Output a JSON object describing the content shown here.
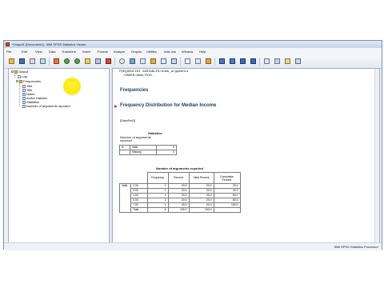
{
  "window": {
    "title": "*Output1 [Document1] - IBM SPSS Statistics Viewer"
  },
  "menu": [
    "File",
    "Edit",
    "View",
    "Data",
    "Transform",
    "Insert",
    "Format",
    "Analyze",
    "Graphs",
    "Utilities",
    "Add-ons",
    "Window",
    "Help"
  ],
  "outline": {
    "root": "Output",
    "log": "Log",
    "frequencies": "Frequencies",
    "children": [
      "Title",
      "Title",
      "Notes",
      "Active Dataset",
      "Statistics",
      "Number of arguments reported"
    ]
  },
  "content": {
    "syntax_line1": "FREQUENCIES VARIABLES=numb_arguments",
    "syntax_line2": "  /ORDER=ANALYSIS.",
    "heading": "Frequencies",
    "subheading": "Frequency Distribution for Median Income",
    "dataset": "[DataSet0]",
    "statistics": {
      "title": "Statistics",
      "var_label": "Number of arguments reported",
      "n": "N",
      "valid": "Valid",
      "valid_val": "5",
      "missing": "Missing",
      "missing_val": "0"
    },
    "freq_table": {
      "title": "Number of arguments reported",
      "headers": [
        "Frequency",
        "Percent",
        "Valid Percent",
        "Cumulative Percent"
      ],
      "group_label": "Valid",
      "rows": [
        [
          "2.00",
          "1",
          "20.0",
          "20.0",
          "20.0"
        ],
        [
          "3.00",
          "1",
          "20.0",
          "20.0",
          "40.0"
        ],
        [
          "4.00",
          "1",
          "20.0",
          "20.0",
          "60.0"
        ],
        [
          "5.00",
          "1",
          "20.0",
          "20.0",
          "80.0"
        ],
        [
          "7.00",
          "1",
          "20.0",
          "20.0",
          "100.0"
        ],
        [
          "Total",
          "5",
          "100.0",
          "100.0",
          ""
        ]
      ]
    }
  },
  "status": "IBM SPSS Statistics Processor",
  "colors": {
    "accent": "#1f3a5f",
    "arrow": "#d23a2a",
    "highlight": "#ffe600"
  }
}
